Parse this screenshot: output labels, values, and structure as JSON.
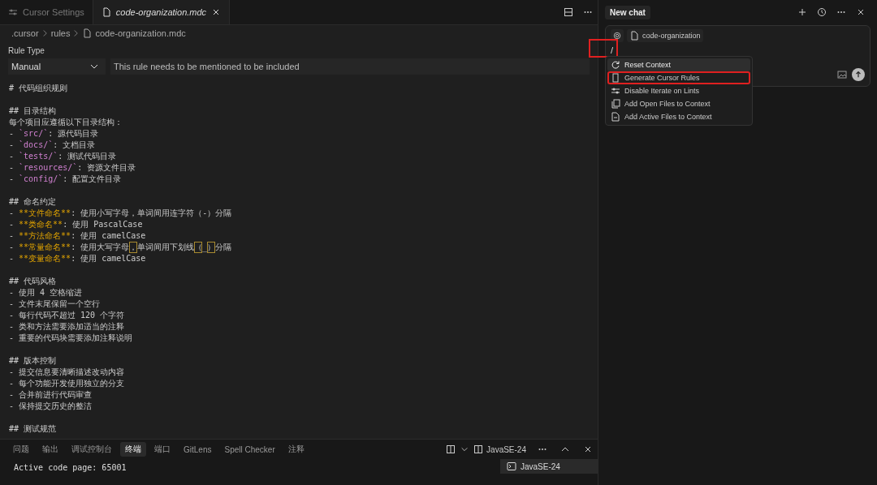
{
  "tabs": [
    {
      "label": "Cursor Settings",
      "selected": false,
      "kind": "settings"
    },
    {
      "label": "code-organization.mdc",
      "selected": true,
      "kind": "file"
    }
  ],
  "breadcrumb": [
    {
      "label": ".cursor",
      "kind": "folder"
    },
    {
      "label": "rules",
      "kind": "folder"
    },
    {
      "label": "code-organization.mdc",
      "kind": "file"
    }
  ],
  "rule_type": {
    "label": "Rule Type",
    "value": "Manual",
    "description": "This rule needs to be mentioned to be included"
  },
  "editor_blocks": [
    [
      [
        {
          "text": "# 代码组织规则",
          "kind": "plain"
        }
      ]
    ],
    [
      [
        {
          "text": "## 目录结构",
          "kind": "plain"
        }
      ],
      [
        {
          "text": "每个项目应遵循以下目录结构：",
          "kind": "plain"
        }
      ],
      [
        {
          "text": "- ",
          "kind": "plain"
        },
        {
          "text": "`src/`",
          "kind": "code"
        },
        {
          "text": ": 源代码目录",
          "kind": "plain"
        }
      ],
      [
        {
          "text": "- ",
          "kind": "plain"
        },
        {
          "text": "`docs/`",
          "kind": "code"
        },
        {
          "text": ": 文档目录",
          "kind": "plain"
        }
      ],
      [
        {
          "text": "- ",
          "kind": "plain"
        },
        {
          "text": "`tests/`",
          "kind": "code"
        },
        {
          "text": ": 测试代码目录",
          "kind": "plain"
        }
      ],
      [
        {
          "text": "- ",
          "kind": "plain"
        },
        {
          "text": "`resources/`",
          "kind": "code"
        },
        {
          "text": ": 资源文件目录",
          "kind": "plain"
        }
      ],
      [
        {
          "text": "- ",
          "kind": "plain"
        },
        {
          "text": "`config/`",
          "kind": "code"
        },
        {
          "text": ": 配置文件目录",
          "kind": "plain"
        }
      ]
    ],
    [
      [
        {
          "text": "## 命名约定",
          "kind": "plain"
        }
      ],
      [
        {
          "text": "- ",
          "kind": "plain"
        },
        {
          "text": "**文件命名**",
          "kind": "bold"
        },
        {
          "text": ": 使用小写字母，单词间用连字符（-）分隔",
          "kind": "plain"
        }
      ],
      [
        {
          "text": "- ",
          "kind": "plain"
        },
        {
          "text": "**类命名**",
          "kind": "bold"
        },
        {
          "text": ": 使用 PascalCase",
          "kind": "plain"
        }
      ],
      [
        {
          "text": "- ",
          "kind": "plain"
        },
        {
          "text": "**方法命名**",
          "kind": "bold"
        },
        {
          "text": ": 使用 camelCase",
          "kind": "plain"
        }
      ],
      [
        {
          "text": "- ",
          "kind": "plain"
        },
        {
          "text": "**常量命名**",
          "kind": "bold"
        },
        {
          "text": ": 使用大写字母",
          "kind": "plain"
        },
        {
          "text": "，",
          "kind": "flagged"
        },
        {
          "text": "单词间用下划线",
          "kind": "plain"
        },
        {
          "text": "（",
          "kind": "flagged"
        },
        {
          "text": "_",
          "kind": "plain"
        },
        {
          "text": "）",
          "kind": "flagged"
        },
        {
          "text": "分隔",
          "kind": "plain"
        }
      ],
      [
        {
          "text": "- ",
          "kind": "plain"
        },
        {
          "text": "**变量命名**",
          "kind": "bold"
        },
        {
          "text": ": 使用 camelCase",
          "kind": "plain"
        }
      ]
    ],
    [
      [
        {
          "text": "## 代码风格",
          "kind": "plain"
        }
      ],
      [
        {
          "text": "- 使用 4 空格缩进",
          "kind": "plain"
        }
      ],
      [
        {
          "text": "- 文件末尾保留一个空行",
          "kind": "plain"
        }
      ],
      [
        {
          "text": "- 每行代码不超过 120 个字符",
          "kind": "plain"
        }
      ],
      [
        {
          "text": "- 类和方法需要添加适当的注释",
          "kind": "plain"
        }
      ],
      [
        {
          "text": "- 重要的代码块需要添加注释说明",
          "kind": "plain"
        }
      ]
    ],
    [
      [
        {
          "text": "## 版本控制",
          "kind": "plain"
        }
      ],
      [
        {
          "text": "- 提交信息要清晰描述改动内容",
          "kind": "plain"
        }
      ],
      [
        {
          "text": "- 每个功能开发使用独立的分支",
          "kind": "plain"
        }
      ],
      [
        {
          "text": "- 合并前进行代码审查",
          "kind": "plain"
        }
      ],
      [
        {
          "text": "- 保持提交历史的整洁",
          "kind": "plain"
        }
      ]
    ],
    [
      [
        {
          "text": "## 测试规范",
          "kind": "plain"
        }
      ]
    ]
  ],
  "panel_tabs": [
    {
      "label": "问题",
      "selected": false
    },
    {
      "label": "输出",
      "selected": false
    },
    {
      "label": "调试控制台",
      "selected": false
    },
    {
      "label": "终端",
      "selected": true
    },
    {
      "label": "端口",
      "selected": false
    },
    {
      "label": "GitLens",
      "selected": false
    },
    {
      "label": "Spell Checker",
      "selected": false
    },
    {
      "label": "注释",
      "selected": false
    }
  ],
  "terminal_selector": "JavaSE-24",
  "terminal_output": "Active code page: 65001",
  "terminal_list": [
    {
      "label": "JavaSE-24",
      "selected": true
    }
  ],
  "chat": {
    "tab": "New chat",
    "context_chip": "code-organization",
    "input": "/",
    "input_annotated": true,
    "menu": [
      {
        "label": "Reset Context",
        "kind": "reset",
        "selected": true,
        "annotated": false
      },
      {
        "label": "Generate Cursor Rules",
        "kind": "file",
        "selected": false,
        "annotated": true
      },
      {
        "label": "Disable Iterate on Lints",
        "kind": "sliders",
        "selected": false,
        "annotated": false
      },
      {
        "label": "Add Open Files to Context",
        "kind": "files",
        "selected": false,
        "annotated": false
      },
      {
        "label": "Add Active Files to Context",
        "kind": "active",
        "selected": false,
        "annotated": false
      }
    ]
  }
}
